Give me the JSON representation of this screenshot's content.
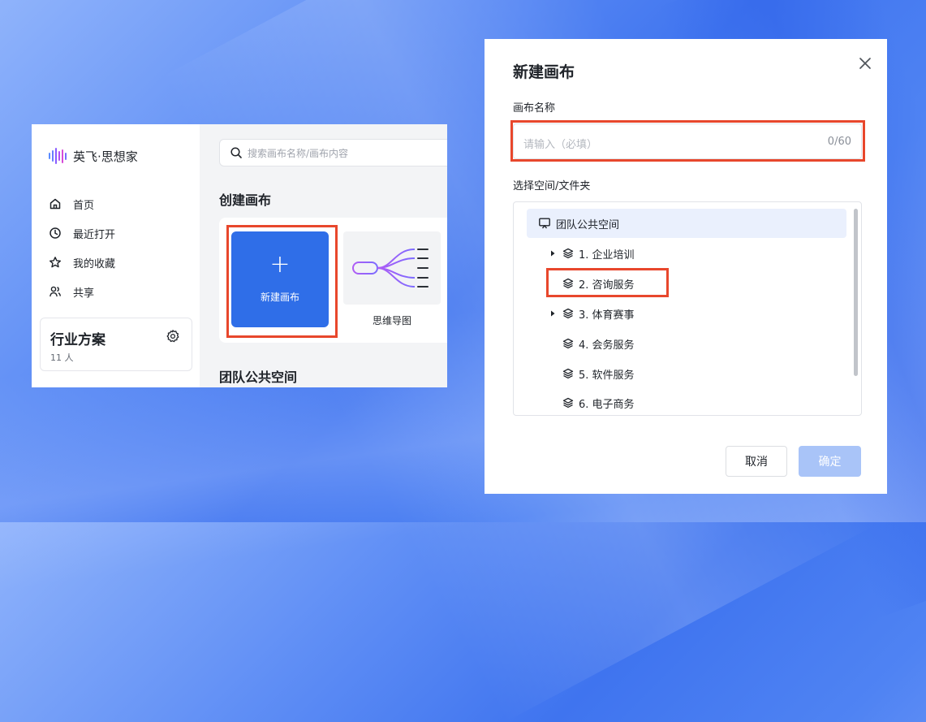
{
  "app": {
    "brand": "英飞·思想家",
    "nav": [
      {
        "label": "首页",
        "icon": "home-icon"
      },
      {
        "label": "最近打开",
        "icon": "clock-icon"
      },
      {
        "label": "我的收藏",
        "icon": "star-icon"
      },
      {
        "label": "共享",
        "icon": "share-users-icon"
      }
    ],
    "team": {
      "name": "行业方案",
      "count": "11 人"
    },
    "search_placeholder": "搜索画布名称/画布内容",
    "create_section_title": "创建画布",
    "new_canvas_plus": "+",
    "new_canvas_label": "新建画布",
    "mindmap_label": "思维导图",
    "team_section_title": "团队公共空间"
  },
  "dialog": {
    "title": "新建画布",
    "name_label": "画布名称",
    "name_placeholder": "请输入（必填）",
    "name_counter": "0/60",
    "space_label": "选择空间/文件夹",
    "tree_root": "团队公共空间",
    "tree_items": [
      {
        "label": "1. 企业培训",
        "expandable": true
      },
      {
        "label": "2. 咨询服务",
        "expandable": false
      },
      {
        "label": "3. 体育赛事",
        "expandable": true
      },
      {
        "label": "4. 会务服务",
        "expandable": false
      },
      {
        "label": "5. 软件服务",
        "expandable": false
      },
      {
        "label": "6. 电子商务",
        "expandable": false
      }
    ],
    "cancel_label": "取消",
    "confirm_label": "确定"
  },
  "colors": {
    "primary": "#2f6ee8",
    "highlight_border": "#e8472c",
    "confirm_disabled": "#a9c4f8",
    "tree_selected_bg": "#eaf0fd"
  }
}
